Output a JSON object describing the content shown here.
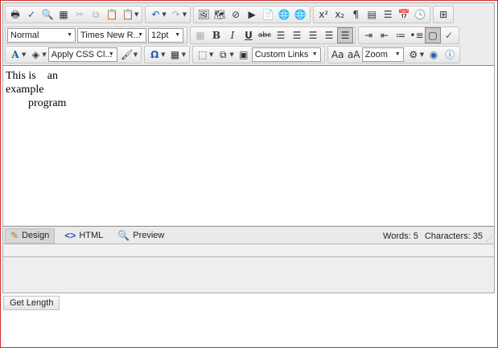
{
  "toolbar": {
    "paragraph_style": "Normal",
    "font_name": "Times New R...",
    "font_size": "12pt",
    "css_class": "Apply CSS Cl...",
    "custom_links": "Custom Links",
    "zoom": "Zoom"
  },
  "content": {
    "line1_a": "This is",
    "line1_b": "an",
    "line2": "example",
    "line3": "program"
  },
  "modes": {
    "design": "Design",
    "html": "HTML",
    "preview": "Preview"
  },
  "stats": {
    "words": "Words: 5",
    "characters": "Characters: 35"
  },
  "get_length_label": "Get Length"
}
